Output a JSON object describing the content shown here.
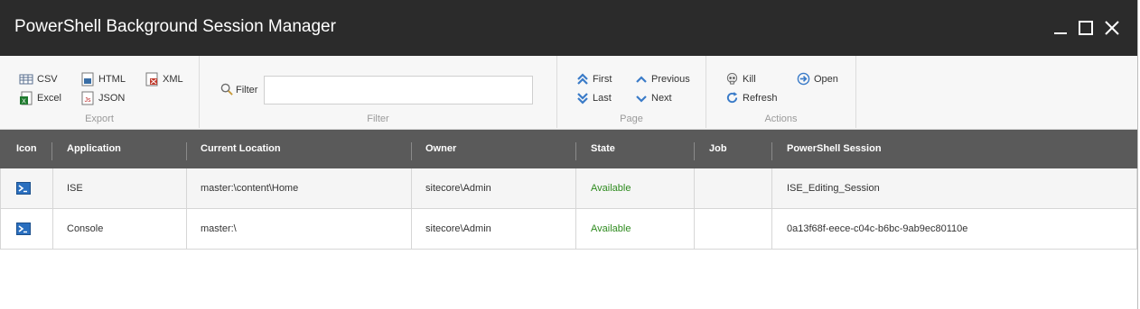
{
  "window": {
    "title": "PowerShell Background Session Manager"
  },
  "ribbon": {
    "export": {
      "label": "Export",
      "csv": "CSV",
      "excel": "Excel",
      "html": "HTML",
      "json": "JSON",
      "xml": "XML"
    },
    "filter": {
      "label": "Filter",
      "field_label": "Filter",
      "value": ""
    },
    "page": {
      "label": "Page",
      "first": "First",
      "last": "Last",
      "previous": "Previous",
      "next": "Next"
    },
    "actions": {
      "label": "Actions",
      "kill": "Kill",
      "refresh": "Refresh",
      "open": "Open"
    }
  },
  "grid": {
    "columns": [
      "Icon",
      "Application",
      "Current Location",
      "Owner",
      "State",
      "Job",
      "PowerShell Session"
    ],
    "rows": [
      {
        "application": "ISE",
        "location": "master:\\content\\Home",
        "owner": "sitecore\\Admin",
        "state": "Available",
        "job": "",
        "session": "ISE_Editing_Session"
      },
      {
        "application": "Console",
        "location": "master:\\",
        "owner": "sitecore\\Admin",
        "state": "Available",
        "job": "",
        "session": "0a13f68f-eece-c04c-b6bc-9ab9ec80110e"
      }
    ]
  },
  "colors": {
    "titlebar": "#2b2b2b",
    "header": "#5a5a5a",
    "available": "#2e8b1e",
    "accent": "#3a7bc8"
  }
}
